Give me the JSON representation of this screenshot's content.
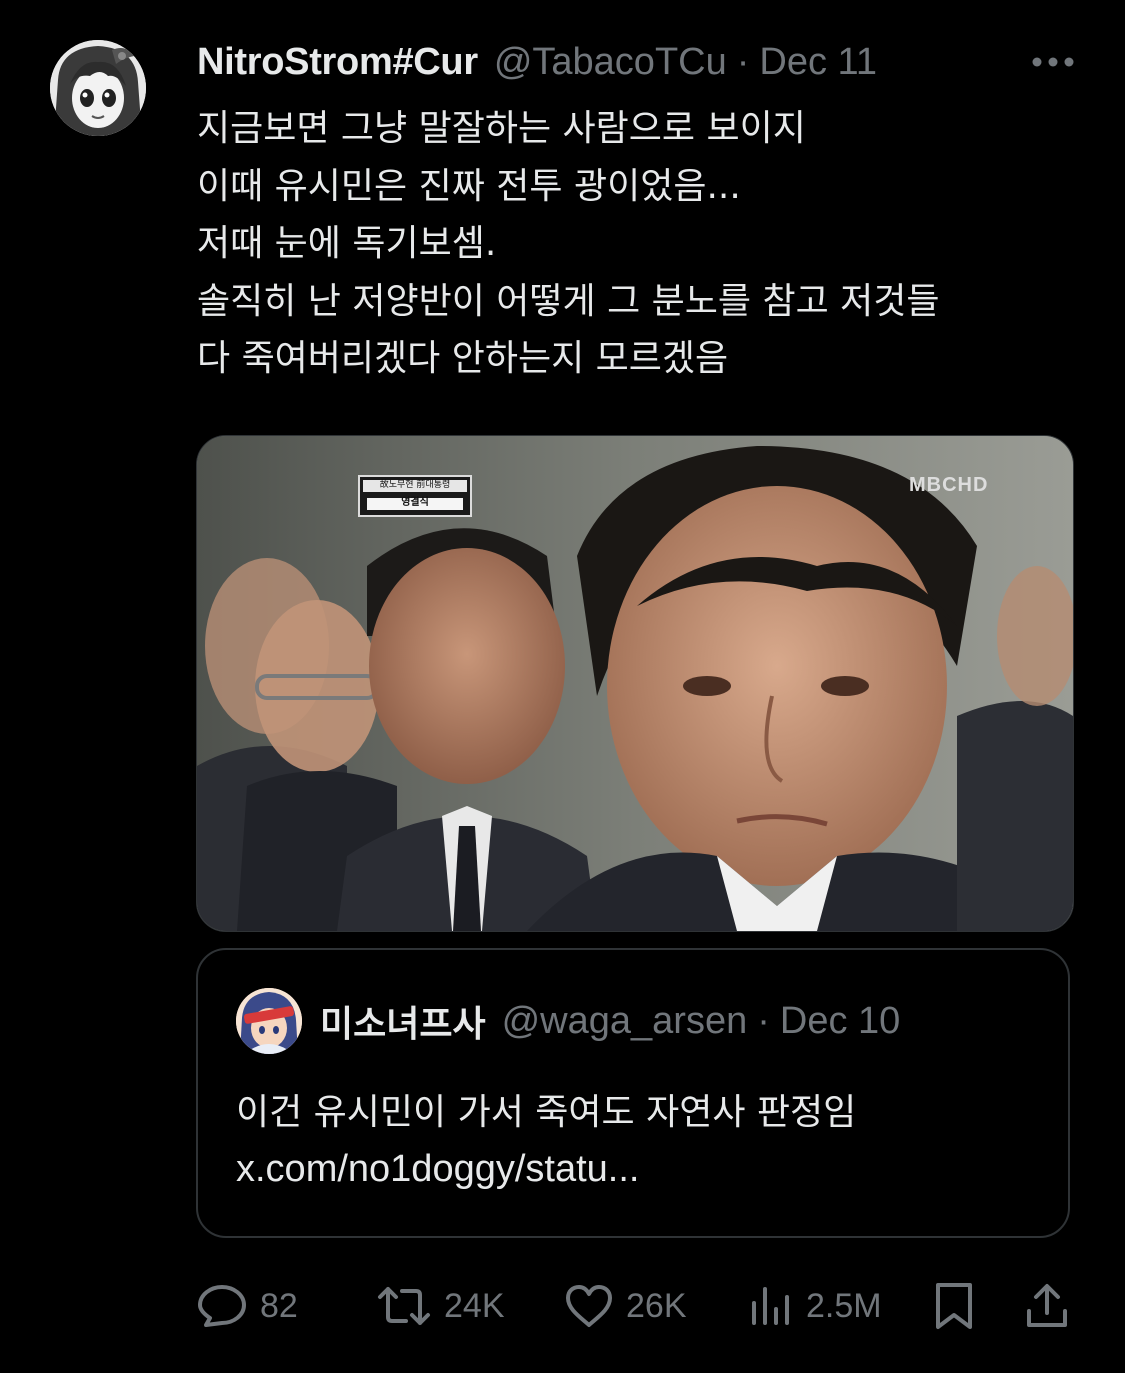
{
  "tweet": {
    "display_name": "NitroStrom#Cur",
    "handle": "@TabacoTCu",
    "separator": "·",
    "date": "Dec 11",
    "text_lines": [
      "지금보면 그냥 말잘하는 사람으로 보이지",
      "이때 유시민은 진짜 전투 광이었음...",
      "저때 눈에 독기보셈.",
      "솔직히 난 저양반이 어떻게 그 분노를 참고 저것들",
      "다 죽여버리겠다 안하는지 모르겠음"
    ],
    "media": {
      "broadcaster_logo": "MBCHD",
      "caption_top": "故노무현 前대통령",
      "caption_bottom": "영결식"
    }
  },
  "quote": {
    "display_name": "미소녀프사",
    "handle": "@waga_arsen",
    "separator": "·",
    "date": "Dec 10",
    "text": "이건 유시민이 가서 죽여도 자연사 판정임",
    "link": "x.com/no1doggy/statu..."
  },
  "actions": {
    "replies": "82",
    "reposts": "24K",
    "likes": "26K",
    "views": "2.5M"
  },
  "icons": {
    "more": "more-horizontal-icon",
    "reply": "reply-bubble-icon",
    "repost": "repost-arrows-icon",
    "like": "heart-icon",
    "views": "bar-chart-icon",
    "bookmark": "bookmark-icon",
    "share": "share-upload-icon"
  },
  "colors": {
    "background": "#000000",
    "text_primary": "#e7e9ea",
    "text_secondary": "#71767b",
    "border": "#2f3336"
  }
}
